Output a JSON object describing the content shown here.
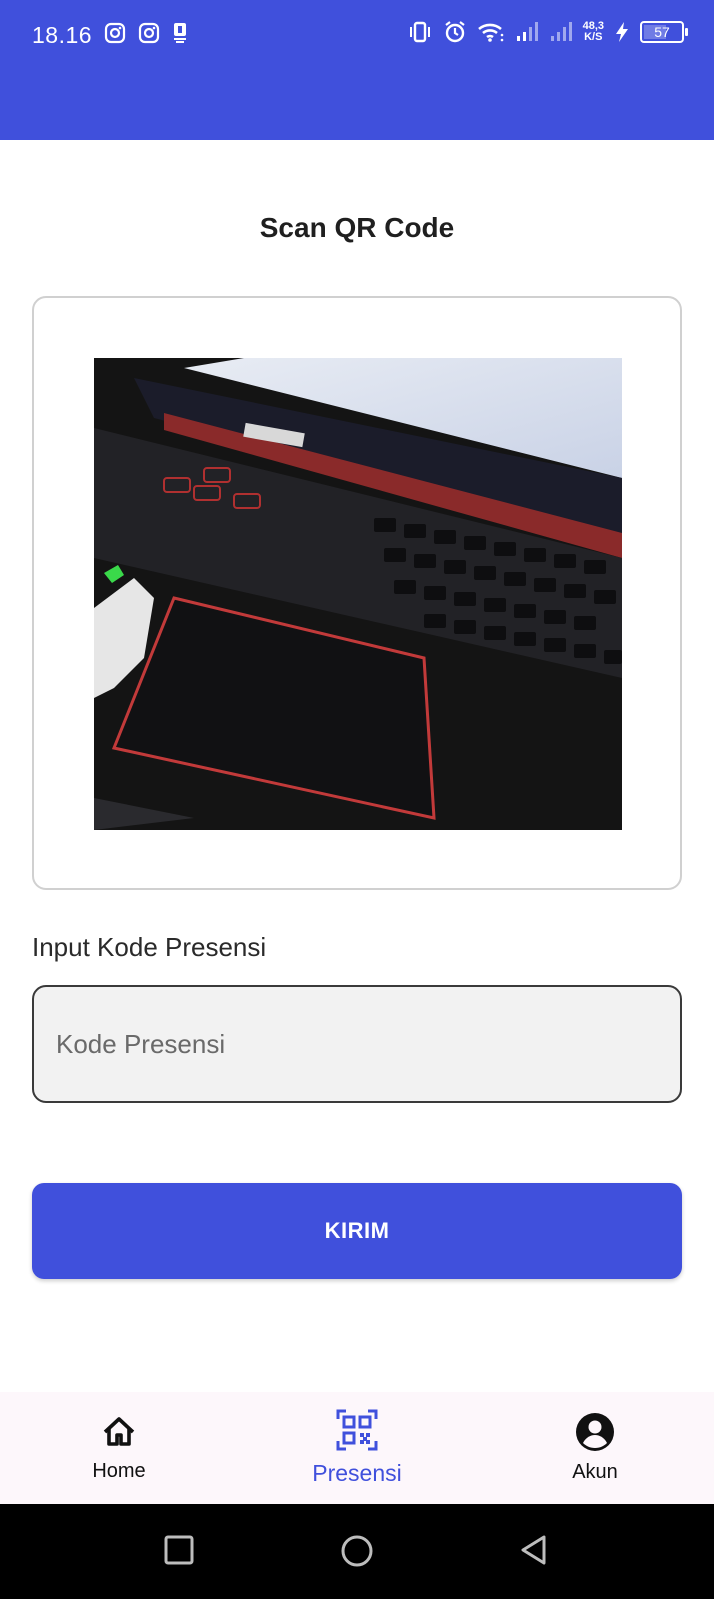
{
  "status_bar": {
    "time": "18.16",
    "net_speed_value": "48,3",
    "net_speed_unit": "K/S",
    "battery": "57"
  },
  "page": {
    "title": "Scan QR Code"
  },
  "form": {
    "input_label": "Input Kode Presensi",
    "input_placeholder": "Kode Presensi",
    "input_value": "",
    "submit_label": "KIRIM"
  },
  "bottom_nav": {
    "items": [
      {
        "label": "Home",
        "icon": "home-icon",
        "active": false
      },
      {
        "label": "Presensi",
        "icon": "qr-code-icon",
        "active": true
      },
      {
        "label": "Akun",
        "icon": "account-icon",
        "active": false
      }
    ]
  },
  "colors": {
    "primary": "#4050DC",
    "nav_background": "#fdf7fb",
    "field_background": "#f2f2f2"
  }
}
